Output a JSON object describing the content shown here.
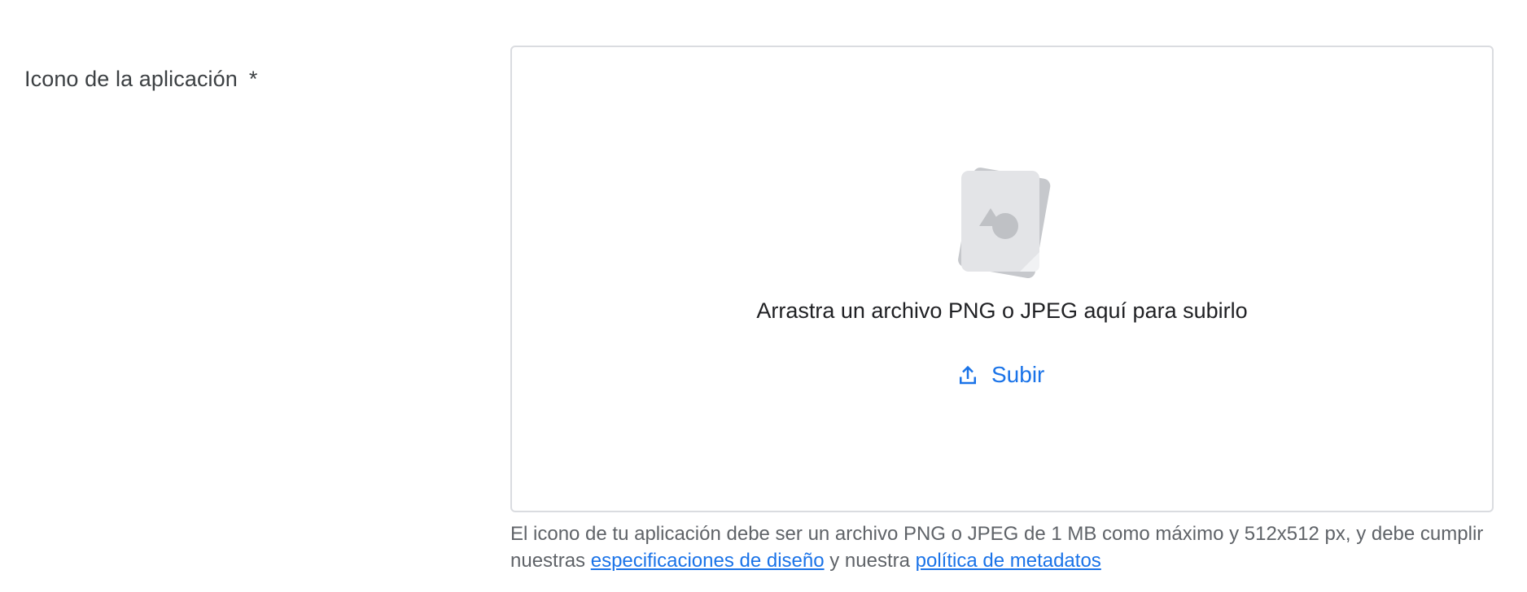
{
  "field": {
    "label": "Icono de la aplicación",
    "required_mark": "*"
  },
  "dropzone": {
    "text": "Arrastra un archivo PNG o JPEG aquí para subirlo",
    "upload_label": "Subir",
    "upload_icon": "upload-icon",
    "illustration_icon": "image-file-stack-icon"
  },
  "help": {
    "text_before": "El icono de tu aplicación debe ser un archivo PNG o JPEG de 1 MB como máximo y 512x512 px, y debe cumplir nuestras",
    "link1": "especificaciones de diseño",
    "text_middle": "y nuestra",
    "link2": "política de metadatos"
  },
  "colors": {
    "accent": "#1a73e8",
    "label": "#3c4043",
    "border": "#dadce0",
    "muted": "#5f6368"
  }
}
